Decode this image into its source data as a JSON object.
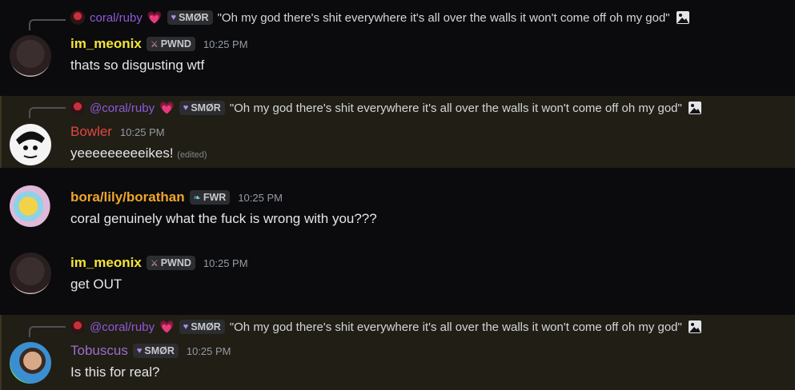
{
  "quoted": {
    "author": "coral/ruby",
    "author_mention": "@coral/ruby",
    "heart": "💗",
    "tag": "SMØR",
    "tag_icon": "heart-icon",
    "text": "\"Oh my god there's shit everywhere it's all over the walls it won't come off oh my god\""
  },
  "messages": [
    {
      "user": "im_meonix",
      "tag": "PWND",
      "tag_icon": "sword-icon",
      "time": "10:25 PM",
      "text": "thats so disgusting wtf"
    },
    {
      "user": "Bowler",
      "time": "10:25 PM",
      "text": "yeeeeeeeeeikes!",
      "edited": "(edited)"
    },
    {
      "user": "bora/lily/borathan",
      "tag": "FWR",
      "tag_icon": "feather-icon",
      "time": "10:25 PM",
      "text": "coral genuinely what the fuck is wrong with you???"
    },
    {
      "user": "im_meonix",
      "tag": "PWND",
      "tag_icon": "sword-icon",
      "time": "10:25 PM",
      "text": "get OUT"
    },
    {
      "user": "Tobuscus",
      "tag": "SMØR",
      "tag_icon": "heart-icon",
      "time": "10:25 PM",
      "text": "Is this for real?"
    }
  ],
  "colors": {
    "background": "#0b0b0d",
    "mention_highlight": "#211e16",
    "meonix": "#f5e53a",
    "bowler": "#e0483f",
    "lily": "#f0a52a",
    "tobuscus": "#9b6fcf",
    "coral": "#8f59d9"
  }
}
